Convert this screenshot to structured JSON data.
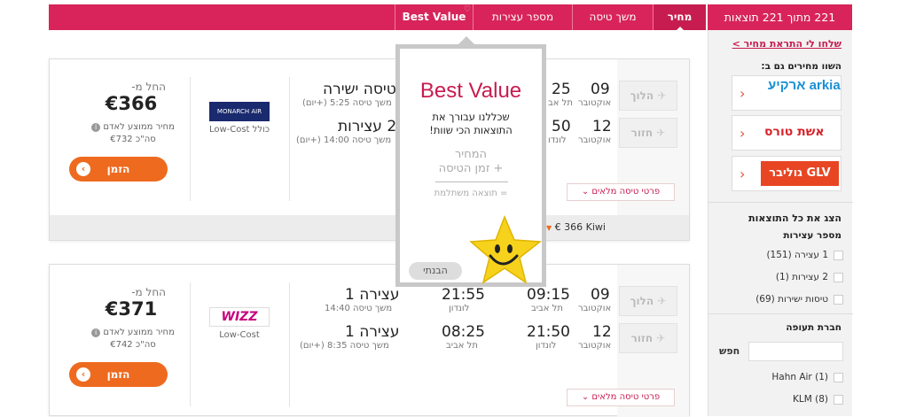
{
  "sort_bar": {
    "tabs": [
      {
        "label": "מחיר"
      },
      {
        "label": "משך טיסה"
      },
      {
        "label": "מספר עצירות"
      },
      {
        "label": "Best Value"
      }
    ]
  },
  "header": {
    "results_count": "221 מתוך 221 תוצאות"
  },
  "sidebar": {
    "alert_link": "שלחו לי התראת מחיר >",
    "compare_heading": "השוו מחירים גם ב:",
    "providers": [
      {
        "name": "arkia ארקיע"
      },
      {
        "name": "אשת טורס"
      },
      {
        "name": "GLV גוליבר"
      }
    ],
    "show_all": "הצג את כל התוצאות",
    "stops_heading": "מספר עצירות",
    "stops_options": [
      {
        "label": "1 עצירה (151)"
      },
      {
        "label": "2 עצירות (1)"
      },
      {
        "label": "טיסות ישירות (69)"
      }
    ],
    "airline_heading": "חברת תעופה",
    "search_label": "חפש",
    "airlines": [
      {
        "label": "(1) Hahn Air"
      },
      {
        "label": "(8) KLM"
      }
    ]
  },
  "popover": {
    "title": "Best Value",
    "text_line1": "שכללנו עבורך את",
    "text_line2": "התוצאות הכי שוות!",
    "hand_line1": "המחיר",
    "hand_line2": "+ זמן הטיסה",
    "hand_line3": "= תוצאה משתלמת",
    "button": "הבנתי"
  },
  "results": [
    {
      "price_from": "החל מ-",
      "price": "€366",
      "per_person": "מחיר ממוצע לאדם",
      "total": "סה\"כ €732",
      "book": "הזמן",
      "airline_logo_text": "MONARCH AIR",
      "airline_label": "Low-Cost כולל",
      "outbound": {
        "dir": "הלוך",
        "day": "09",
        "month": "אוקטובר",
        "dep_time": "25",
        "dep_city": "תל אב",
        "stops": "טיסה ישירה",
        "duration": "משך טיסה 5:25 (+יום)"
      },
      "inbound": {
        "dir": "חזור",
        "day": "12",
        "month": "אוקטובר",
        "dep_time": "50",
        "dep_city": "לונדו",
        "stops": "2 עצירות",
        "duration": "משך טיסה 14:00 (+יום)"
      },
      "details": "פרטי טיסה מלאים",
      "other_provider": "€ 366 Kiwi"
    },
    {
      "price_from": "החל מ-",
      "price": "€371",
      "per_person": "מחיר ממוצע לאדם",
      "total": "סה\"כ €742",
      "book": "הזמן",
      "airline_logo_text": "WIZZ",
      "airline_label": "Low-Cost",
      "outbound": {
        "dir": "הלוך",
        "day": "09",
        "month": "אוקטובר",
        "dep_time": "09:15",
        "dep_city": "תל אביב",
        "arr_time": "21:55",
        "arr_city": "לונדון",
        "stops": "עצירה 1",
        "duration": "משך טיסה 14:40"
      },
      "inbound": {
        "dir": "חזור",
        "day": "12",
        "month": "אוקטובר",
        "dep_time": "21:50",
        "dep_city": "לונדון",
        "arr_time": "08:25",
        "arr_city": "תל אביב",
        "stops": "עצירה 1",
        "duration": "משך טיסה 8:35 (+יום)"
      },
      "details": "פרטי טיסה מלאים"
    }
  ],
  "colors": {
    "brand": "#d8245a",
    "book_button": "#ee6a1f"
  }
}
